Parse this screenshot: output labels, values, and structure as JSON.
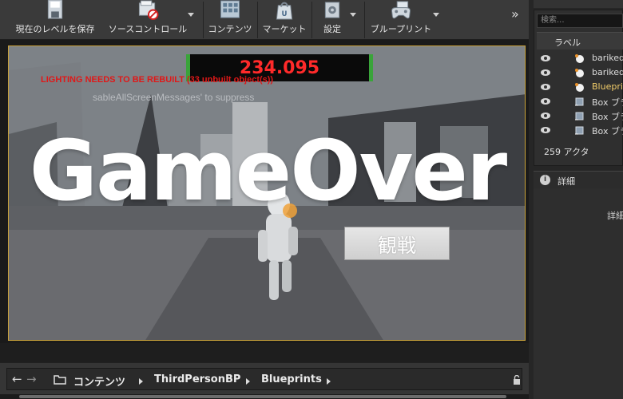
{
  "toolbar": {
    "save_level": "現在のレベルを保存",
    "source_control": "ソースコントロール",
    "content": "コンテンツ",
    "marketplace": "マーケット",
    "settings": "設定",
    "blueprints": "ブループリント",
    "more": "»"
  },
  "viewport": {
    "score": "234.095",
    "lighting_warning": "LIGHTING NEEDS TO BE REBUILT (33 unbuilt object(s))",
    "suppress_hint": "sableAllScreenMessages' to suppress",
    "game_over": "GameOver",
    "spectate_button": "観戦"
  },
  "content_browser": {
    "crumbs": [
      "コンテンツ",
      "ThirdPersonBP",
      "Blueprints"
    ]
  },
  "outliner": {
    "search_placeholder": "検索...",
    "label_header": "ラベル",
    "rows": [
      {
        "name": "bariked",
        "kind": "actor"
      },
      {
        "name": "bariked",
        "kind": "actor"
      },
      {
        "name": "Bluepri",
        "kind": "blueprint"
      },
      {
        "name": "Box ブラ",
        "kind": "box"
      },
      {
        "name": "Box ブラ",
        "kind": "box"
      },
      {
        "name": "Box ブラ",
        "kind": "box"
      }
    ],
    "actor_count": "259 アクタ"
  },
  "details": {
    "tab_label": "詳細",
    "body_text": "詳細"
  },
  "colors": {
    "viewport_border": "#c9a23a",
    "score_text": "#ff2a2a",
    "score_frame": "#3aa43a",
    "warning_text": "#e01818",
    "blueprint_label": "#f2cd6a"
  }
}
